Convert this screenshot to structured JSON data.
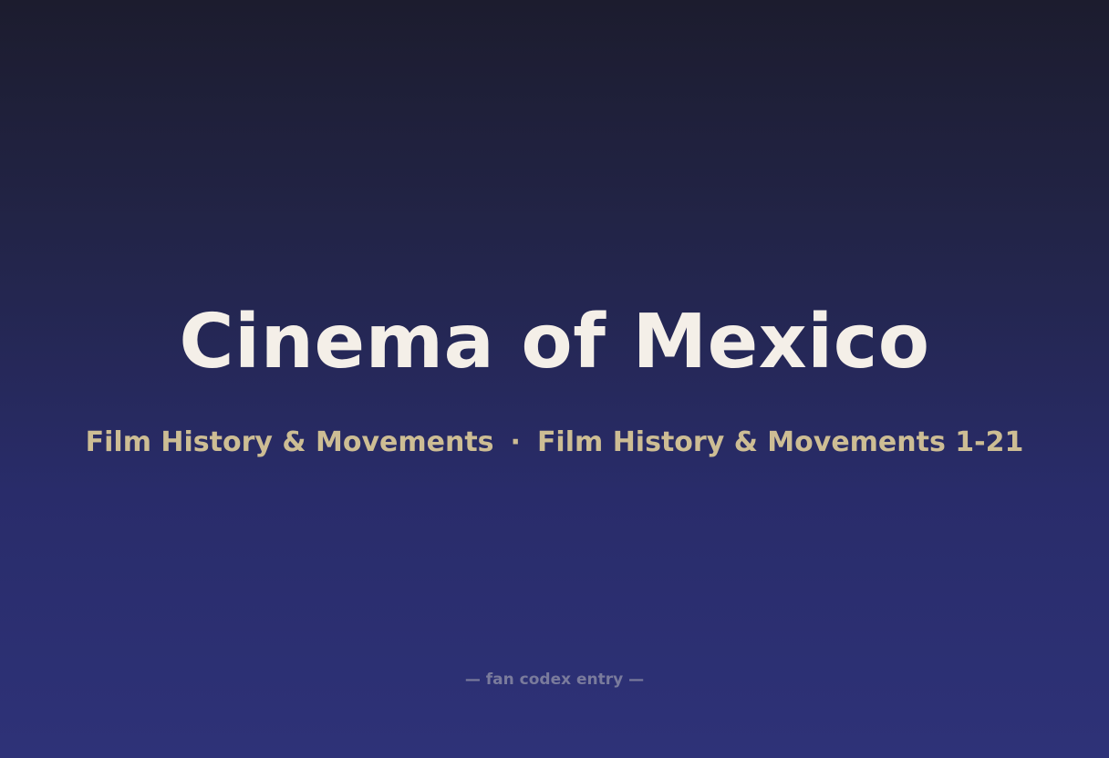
{
  "title": "Cinema of Mexico",
  "subtitle": {
    "left": "Film History & Movements",
    "separator": "·",
    "right": "Film History & Movements 1-21"
  },
  "footer": "— fan codex entry —",
  "colors": {
    "background_top": "#1c1c2e",
    "background_bottom": "#2e3278",
    "title": "#f4efe8",
    "subtitle": "#cdbd94",
    "footer": "#7a7b9c"
  }
}
